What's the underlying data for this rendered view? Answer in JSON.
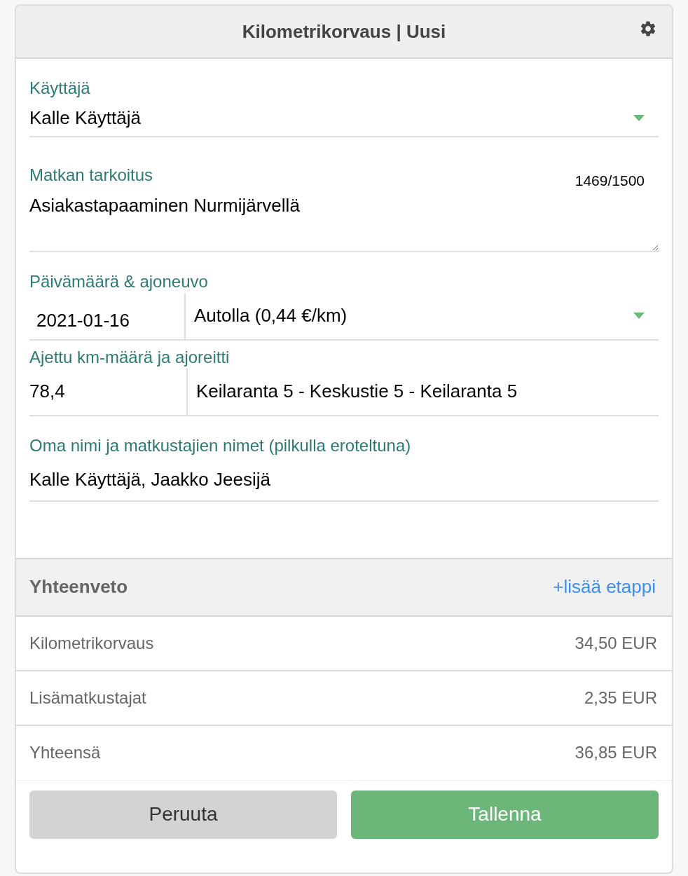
{
  "header": {
    "title": "Kilometrikorvaus | Uusi"
  },
  "user": {
    "label": "Käyttäjä",
    "value": "Kalle Käyttäjä"
  },
  "purpose": {
    "label": "Matkan tarkoitus",
    "counter": "1469/1500",
    "value": "Asiakastapaaminen Nurmijärvellä"
  },
  "date_vehicle": {
    "label": "Päivämäärä & ajoneuvo",
    "date": "2021-01-16",
    "vehicle": "Autolla (0,44 €/km)"
  },
  "distance_route": {
    "label": "Ajettu km-määrä ja ajoreitti",
    "km": "78,4",
    "route": "Keilaranta 5 - Keskustie 5 - Keilaranta 5"
  },
  "travellers": {
    "label": "Oma nimi ja matkustajien nimet (pilkulla eroteltuna)",
    "value": "Kalle Käyttäjä, Jaakko Jeesijä"
  },
  "summary": {
    "title": "Yhteenveto",
    "add_link": "+lisää etappi",
    "rows": [
      {
        "label": "Kilometrikorvaus",
        "amount": "34,50 EUR"
      },
      {
        "label": "Lisämatkustajat",
        "amount": "2,35 EUR"
      },
      {
        "label": "Yhteensä",
        "amount": "36,85 EUR"
      }
    ]
  },
  "buttons": {
    "cancel": "Peruuta",
    "save": "Tallenna"
  }
}
